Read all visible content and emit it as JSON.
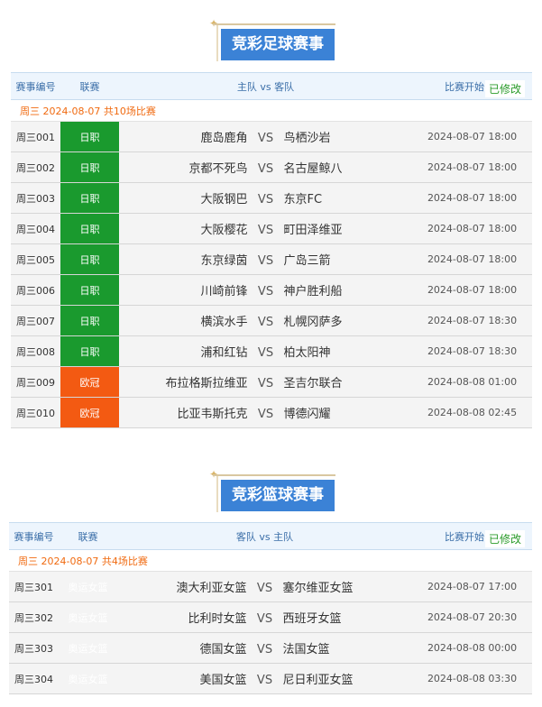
{
  "football": {
    "title": "竞彩足球赛事",
    "headers": {
      "id": "赛事编号",
      "league": "联赛",
      "teams": "主队 vs 客队",
      "time": "比赛开始",
      "modified": "已修改"
    },
    "day_label": "周三 2024-08-07 共10场比赛",
    "rows": [
      {
        "id": "周三001",
        "league": "日职",
        "league_color": "#1a9a2e",
        "home": "鹿岛鹿角",
        "vs": "VS",
        "away": "鸟栖沙岩",
        "time": "2024-08-07 18:00"
      },
      {
        "id": "周三002",
        "league": "日职",
        "league_color": "#1a9a2e",
        "home": "京都不死鸟",
        "vs": "VS",
        "away": "名古屋鲸八",
        "time": "2024-08-07 18:00"
      },
      {
        "id": "周三003",
        "league": "日职",
        "league_color": "#1a9a2e",
        "home": "大阪钢巴",
        "vs": "VS",
        "away": "东京FC",
        "time": "2024-08-07 18:00"
      },
      {
        "id": "周三004",
        "league": "日职",
        "league_color": "#1a9a2e",
        "home": "大阪樱花",
        "vs": "VS",
        "away": "町田泽维亚",
        "time": "2024-08-07 18:00"
      },
      {
        "id": "周三005",
        "league": "日职",
        "league_color": "#1a9a2e",
        "home": "东京绿茵",
        "vs": "VS",
        "away": "广岛三箭",
        "time": "2024-08-07 18:00"
      },
      {
        "id": "周三006",
        "league": "日职",
        "league_color": "#1a9a2e",
        "home": "川崎前锋",
        "vs": "VS",
        "away": "神户胜利船",
        "time": "2024-08-07 18:00"
      },
      {
        "id": "周三007",
        "league": "日职",
        "league_color": "#1a9a2e",
        "home": "横滨水手",
        "vs": "VS",
        "away": "札幌冈萨多",
        "time": "2024-08-07 18:30"
      },
      {
        "id": "周三008",
        "league": "日职",
        "league_color": "#1a9a2e",
        "home": "浦和红钻",
        "vs": "VS",
        "away": "柏太阳神",
        "time": "2024-08-07 18:30"
      },
      {
        "id": "周三009",
        "league": "欧冠",
        "league_color": "#f35a12",
        "home": "布拉格斯拉维亚",
        "vs": "VS",
        "away": "圣吉尔联合",
        "time": "2024-08-08 01:00"
      },
      {
        "id": "周三010",
        "league": "欧冠",
        "league_color": "#f35a12",
        "home": "比亚韦斯托克",
        "vs": "VS",
        "away": "博德闪耀",
        "time": "2024-08-08 02:45"
      }
    ]
  },
  "basketball": {
    "title": "竞彩篮球赛事",
    "headers": {
      "id": "赛事编号",
      "league": "联赛",
      "teams": "客队 vs 主队",
      "time": "比赛开始",
      "modified": "已修改"
    },
    "day_label": "周三 2024-08-07 共4场比赛",
    "rows": [
      {
        "id": "周三301",
        "league": "奥运女篮",
        "home": "澳大利亚女篮",
        "vs": "VS",
        "away": "塞尔维亚女篮",
        "time": "2024-08-07 17:00"
      },
      {
        "id": "周三302",
        "league": "奥运女篮",
        "home": "比利时女篮",
        "vs": "VS",
        "away": "西班牙女篮",
        "time": "2024-08-07 20:30"
      },
      {
        "id": "周三303",
        "league": "奥运女篮",
        "home": "德国女篮",
        "vs": "VS",
        "away": "法国女篮",
        "time": "2024-08-08 00:00"
      },
      {
        "id": "周三304",
        "league": "奥运女篮",
        "home": "美国女篮",
        "vs": "VS",
        "away": "尼日利亚女篮",
        "time": "2024-08-08 03:30"
      }
    ]
  }
}
